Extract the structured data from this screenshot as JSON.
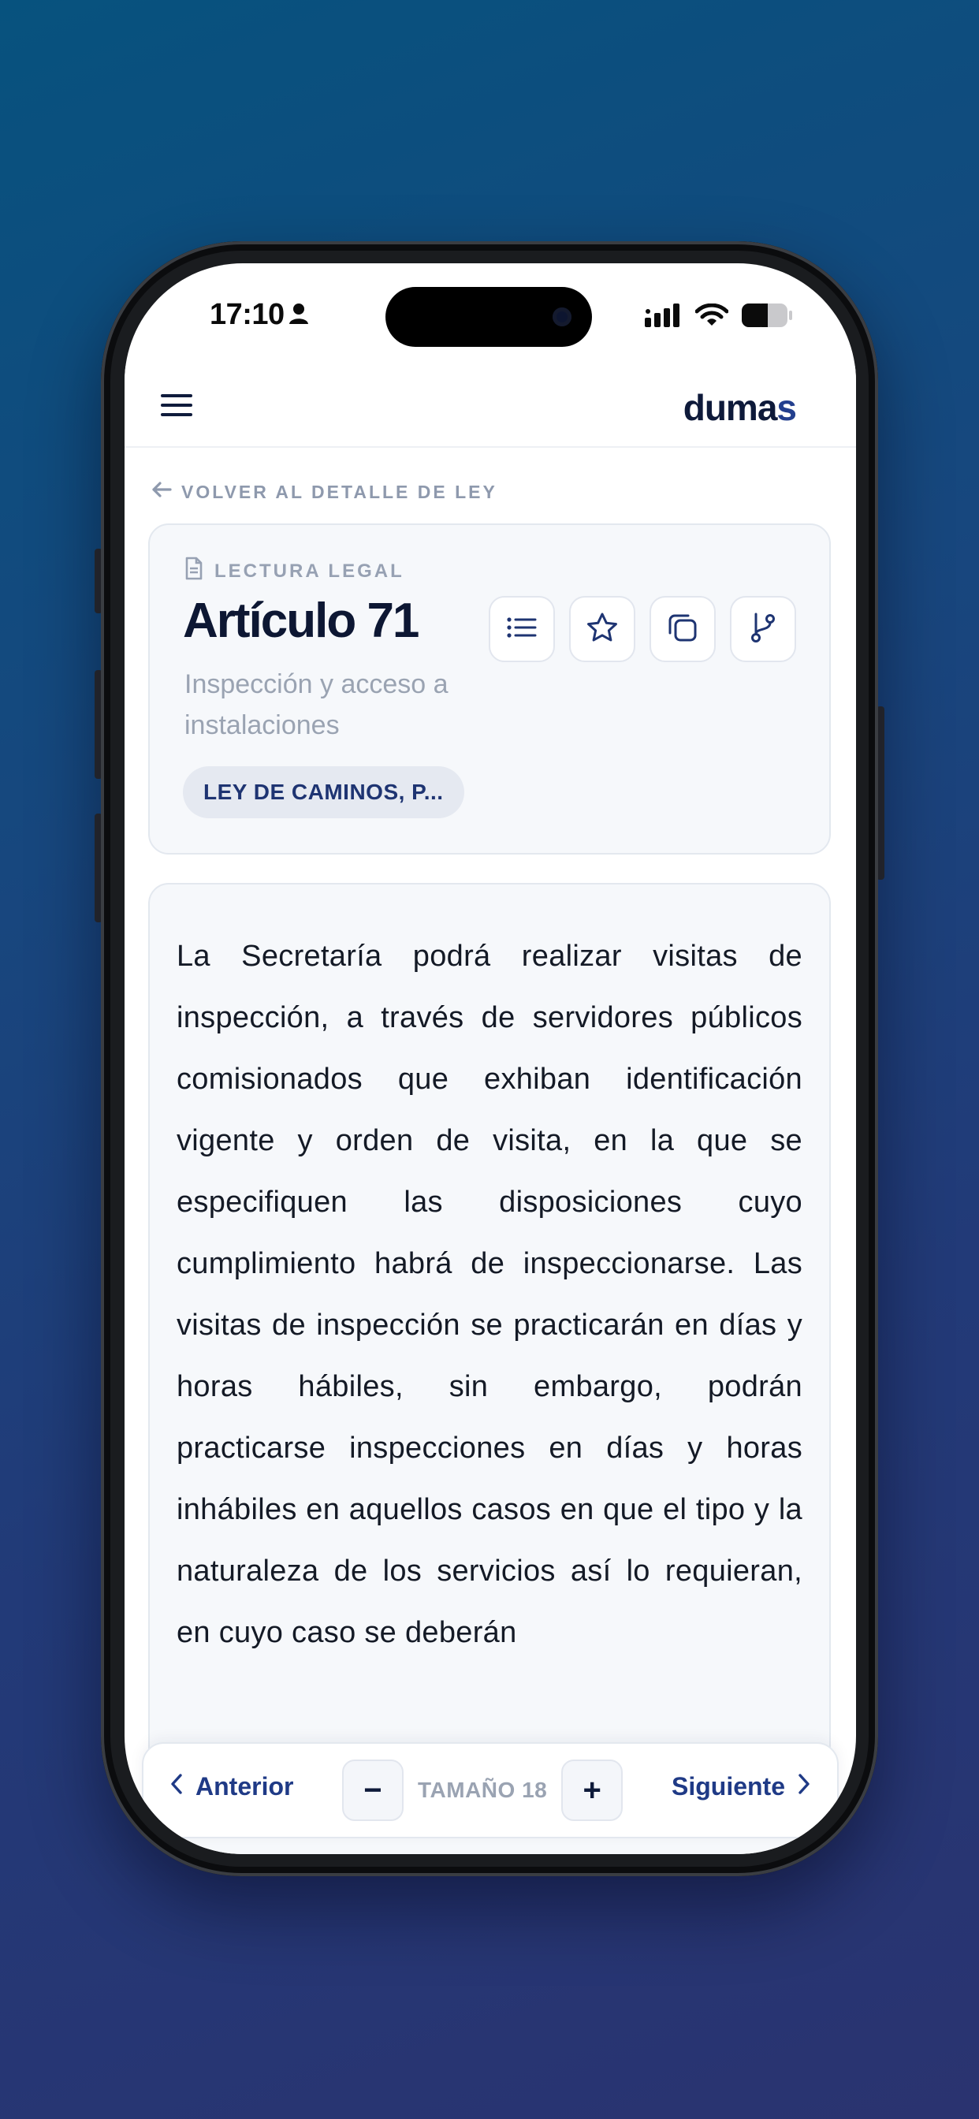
{
  "status_bar": {
    "time": "17:10"
  },
  "header": {
    "brand_main": "duma",
    "brand_accent": "s"
  },
  "back_link": {
    "label": "VOLVER AL DETALLE DE LEY"
  },
  "article": {
    "kicker": "LECTURA LEGAL",
    "title": "Artículo 71",
    "subtitle": "Inspección y acceso a instalaciones",
    "law_chip": "LEY DE CAMINOS, P...",
    "actions": [
      "list-icon",
      "star-icon",
      "copy-icon",
      "branch-icon"
    ],
    "body": "La Secretaría podrá realizar visitas de inspección, a través de servidores públicos comisionados que exhiban identificación vigente y orden de visita, en la que se especifiquen las disposiciones cuyo cumplimiento habrá de inspeccionarse. Las visitas de inspección se practicarán en días y horas hábiles, sin embargo, podrán practicarse inspecciones en días y horas inhábiles en aquellos casos en que el tipo y la naturaleza de los servicios así lo requieran, en cuyo caso se deberán"
  },
  "bottom_bar": {
    "prev_label": "Anterior",
    "next_label": "Siguiente",
    "size_label": "TAMAÑO 18",
    "decrease": "−",
    "increase": "+"
  },
  "colors": {
    "brand": "#0e1a3a",
    "accent": "#233f8e",
    "muted": "#9aa3b2"
  }
}
